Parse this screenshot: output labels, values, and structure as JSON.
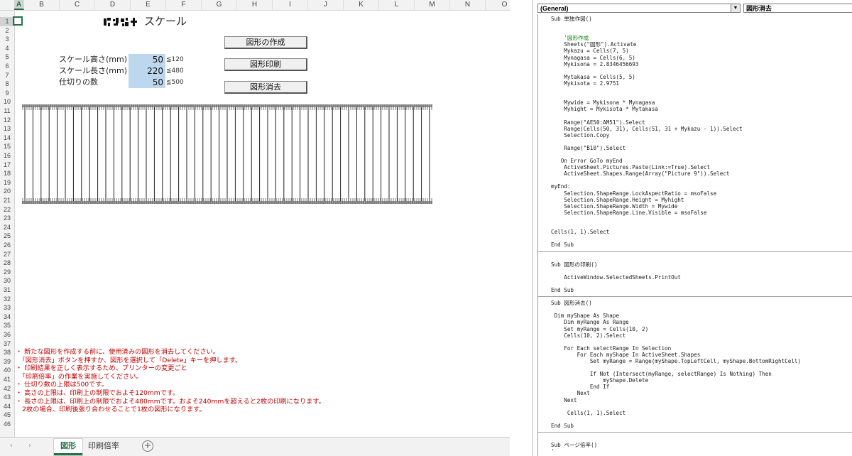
{
  "excel": {
    "columns": [
      "A",
      "B",
      "C",
      "D",
      "E",
      "F",
      "G",
      "H",
      "I",
      "J",
      "K",
      "L",
      "M",
      "N",
      "O"
    ],
    "selected_column": "A",
    "rows": [
      "1",
      "2",
      "3",
      "4",
      "5",
      "6",
      "7",
      "8",
      "9",
      "10",
      "11",
      "12",
      "13",
      "14",
      "15",
      "16",
      "17",
      "18",
      "19",
      "20",
      "21",
      "22",
      "23",
      "24",
      "25",
      "26",
      "27",
      "28",
      "29",
      "30",
      "31",
      "32",
      "33",
      "34",
      "35",
      "36",
      "37",
      "38",
      "39",
      "40",
      "41",
      "42",
      "43",
      "44",
      "45",
      "46"
    ],
    "selected_row": "1",
    "title": "スケール",
    "title_prefix_mark": "blurred logo text",
    "buttons": {
      "create": "図形の作成",
      "print": "図形印刷",
      "erase": "図形消去"
    },
    "params": [
      {
        "label": "スケール高さ(mm)",
        "value": "50",
        "limit": "≦120"
      },
      {
        "label": "スケール長さ(mm)",
        "value": "220",
        "limit": "≦480"
      },
      {
        "label": "仕切りの数",
        "value": "50",
        "limit": "≦500"
      }
    ],
    "scale_divisions": 50,
    "notes": [
      "・ 新たな図形を作成する前に、使用済みの図形を消去してください。",
      "　「図形消去」ボタンを押すか、図形を選択して「Delete」キーを押します。",
      "・ 印刷結果を正しく表示するため、プリンターの変更ごと",
      "　「印刷倍率」の作業を実施してください。",
      "・ 仕切り数の上限は500です。",
      "・ 高さの上限は、印刷上の制限でおよそ120mmです。",
      "・ 長さの上限は、印刷上の制限でおよそ480mmです。およそ240mmを超えると2枚の印刷になります。",
      "　2枚の場合、印刷後張り合わせることで1枚の図形になります。"
    ],
    "tabs": [
      {
        "label": "図形",
        "active": true
      },
      {
        "label": "印刷倍率",
        "active": false
      }
    ],
    "nav_prev": "‹",
    "nav_next": "›",
    "add_sheet": "+"
  },
  "vba": {
    "object_dropdown": "(General)",
    "procedure_dropdown": "図形消去",
    "dropdown_arrow": "▼",
    "code": [
      {
        "t": "Sub 単独作図()"
      },
      {
        "t": ""
      },
      {
        "t": ""
      },
      {
        "t": "    '図形作成",
        "c": true
      },
      {
        "t": "    Sheets(\"図形\").Activate"
      },
      {
        "t": "    Mykazu = Cells(7, 5)"
      },
      {
        "t": "    Mynagasa = Cells(6, 5)"
      },
      {
        "t": "    Mykisona = 2.8346456693"
      },
      {
        "t": ""
      },
      {
        "t": "    Mytakasa = Cells(5, 5)"
      },
      {
        "t": "    Mykisota = 2.9751"
      },
      {
        "t": ""
      },
      {
        "t": ""
      },
      {
        "t": "    Mywide = Mykisona * Mynagasa"
      },
      {
        "t": "    Myhight = Mykisota * Mytakasa"
      },
      {
        "t": ""
      },
      {
        "t": "    Range(\"AE50:AM51\").Select"
      },
      {
        "t": "    Range(Cells(50, 31), Cells(51, 31 + Mykazu - 1)).Select"
      },
      {
        "t": "    Selection.Copy"
      },
      {
        "t": ""
      },
      {
        "t": "    Range(\"B10\").Select"
      },
      {
        "t": ""
      },
      {
        "t": "   On Error GoTo myEnd"
      },
      {
        "t": "    ActiveSheet.Pictures.Paste(Link:=True).Select"
      },
      {
        "t": "    ActiveSheet.Shapes.Range(Array(\"Picture 9\")).Select"
      },
      {
        "t": ""
      },
      {
        "t": "myEnd:"
      },
      {
        "t": "    Selection.ShapeRange.LockAspectRatio = msoFalse"
      },
      {
        "t": "    Selection.ShapeRange.Height = Myhight"
      },
      {
        "t": "    Selection.ShapeRange.Width = Mywide"
      },
      {
        "t": "    Selection.ShapeRange.Line.Visible = msoFalse"
      },
      {
        "t": ""
      },
      {
        "t": ""
      },
      {
        "t": "Cells(1, 1).Select"
      },
      {
        "t": ""
      },
      {
        "t": "End Sub"
      },
      {
        "t": "",
        "sep": true
      },
      {
        "t": ""
      },
      {
        "t": "Sub 図形の印刷()"
      },
      {
        "t": ""
      },
      {
        "t": "    ActiveWindow.SelectedSheets.PrintOut"
      },
      {
        "t": ""
      },
      {
        "t": "End Sub"
      },
      {
        "t": "",
        "sep": true
      },
      {
        "t": "Sub 図形消去()"
      },
      {
        "t": ""
      },
      {
        "t": " Dim myShape As Shape"
      },
      {
        "t": "    Dim myRange As Range"
      },
      {
        "t": "    Set myRange = Cells(10, 2)"
      },
      {
        "t": "    Cells(10, 2).Select"
      },
      {
        "t": ""
      },
      {
        "t": "    For Each selectRange In Selection"
      },
      {
        "t": "        For Each myShape In ActiveSheet.Shapes"
      },
      {
        "t": "            Set myRange = Range(myShape.TopLeftCell, myShape.BottomRightCell)"
      },
      {
        "t": ""
      },
      {
        "t": "            If Not (Intersect(myRange, selectRange) Is Nothing) Then"
      },
      {
        "t": "                myShape.Delete"
      },
      {
        "t": "            End If"
      },
      {
        "t": "        Next"
      },
      {
        "t": "    Next"
      },
      {
        "t": ""
      },
      {
        "t": "     Cells(1, 1).Select"
      },
      {
        "t": ""
      },
      {
        "t": "End Sub"
      },
      {
        "t": "",
        "sep": true
      },
      {
        "t": ""
      },
      {
        "t": "Sub ページ倍率()"
      },
      {
        "t": "'"
      }
    ]
  }
}
